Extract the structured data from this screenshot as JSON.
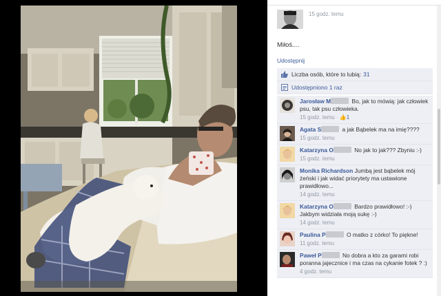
{
  "post": {
    "owner_time": "15 godz. temu",
    "caption": "Miłoś....",
    "share_link": "Udostępnij"
  },
  "ufi": {
    "likes_label": "Liczba osób, które to lubią:",
    "likes_count": "31",
    "shares_label": "Udostępniono 1 raz"
  },
  "comments": [
    {
      "author": "Jarosław M",
      "text": "Bo, jak to mówią: jak człowiek psu, tak psu człowieka.",
      "time": "15 godz. temu",
      "likes": "1"
    },
    {
      "author": "Agata S",
      "text": "a jak Bąbelek ma na imię????",
      "time": "15 godz. temu",
      "likes": ""
    },
    {
      "author": "Katarzyna O",
      "text": "No jak to jak??? Zbyniu :-)",
      "time": "15 godz. temu",
      "likes": ""
    },
    {
      "author": "Monika Richardson",
      "text": "Jumbą jest bąbelek mój żeński i jak widać priorytety ma ustawione prawidłowo...",
      "time": "14 godz. temu",
      "likes": ""
    },
    {
      "author": "Katarzyna O",
      "text": "Bardzo prawidłowo! :-) Jakbym widziała moją sukę :-)",
      "time": "14 godz. temu",
      "likes": ""
    },
    {
      "author": "Paulina P",
      "text": "O matko z córko! To piękne!",
      "time": "11 godz. temu",
      "likes": ""
    },
    {
      "author": "Paweł P",
      "text": "No dobra a kto za garami robi poranna jajecznice i ma czas na cykanie fotek ? :)",
      "time": "4 godz. temu",
      "likes": ""
    }
  ],
  "colors": {
    "link": "#3b5998",
    "ufi_bg": "#edeff4",
    "meta": "#9197a3"
  },
  "icons": [
    "thumbs-up-icon",
    "share-icon",
    "like-icon"
  ]
}
